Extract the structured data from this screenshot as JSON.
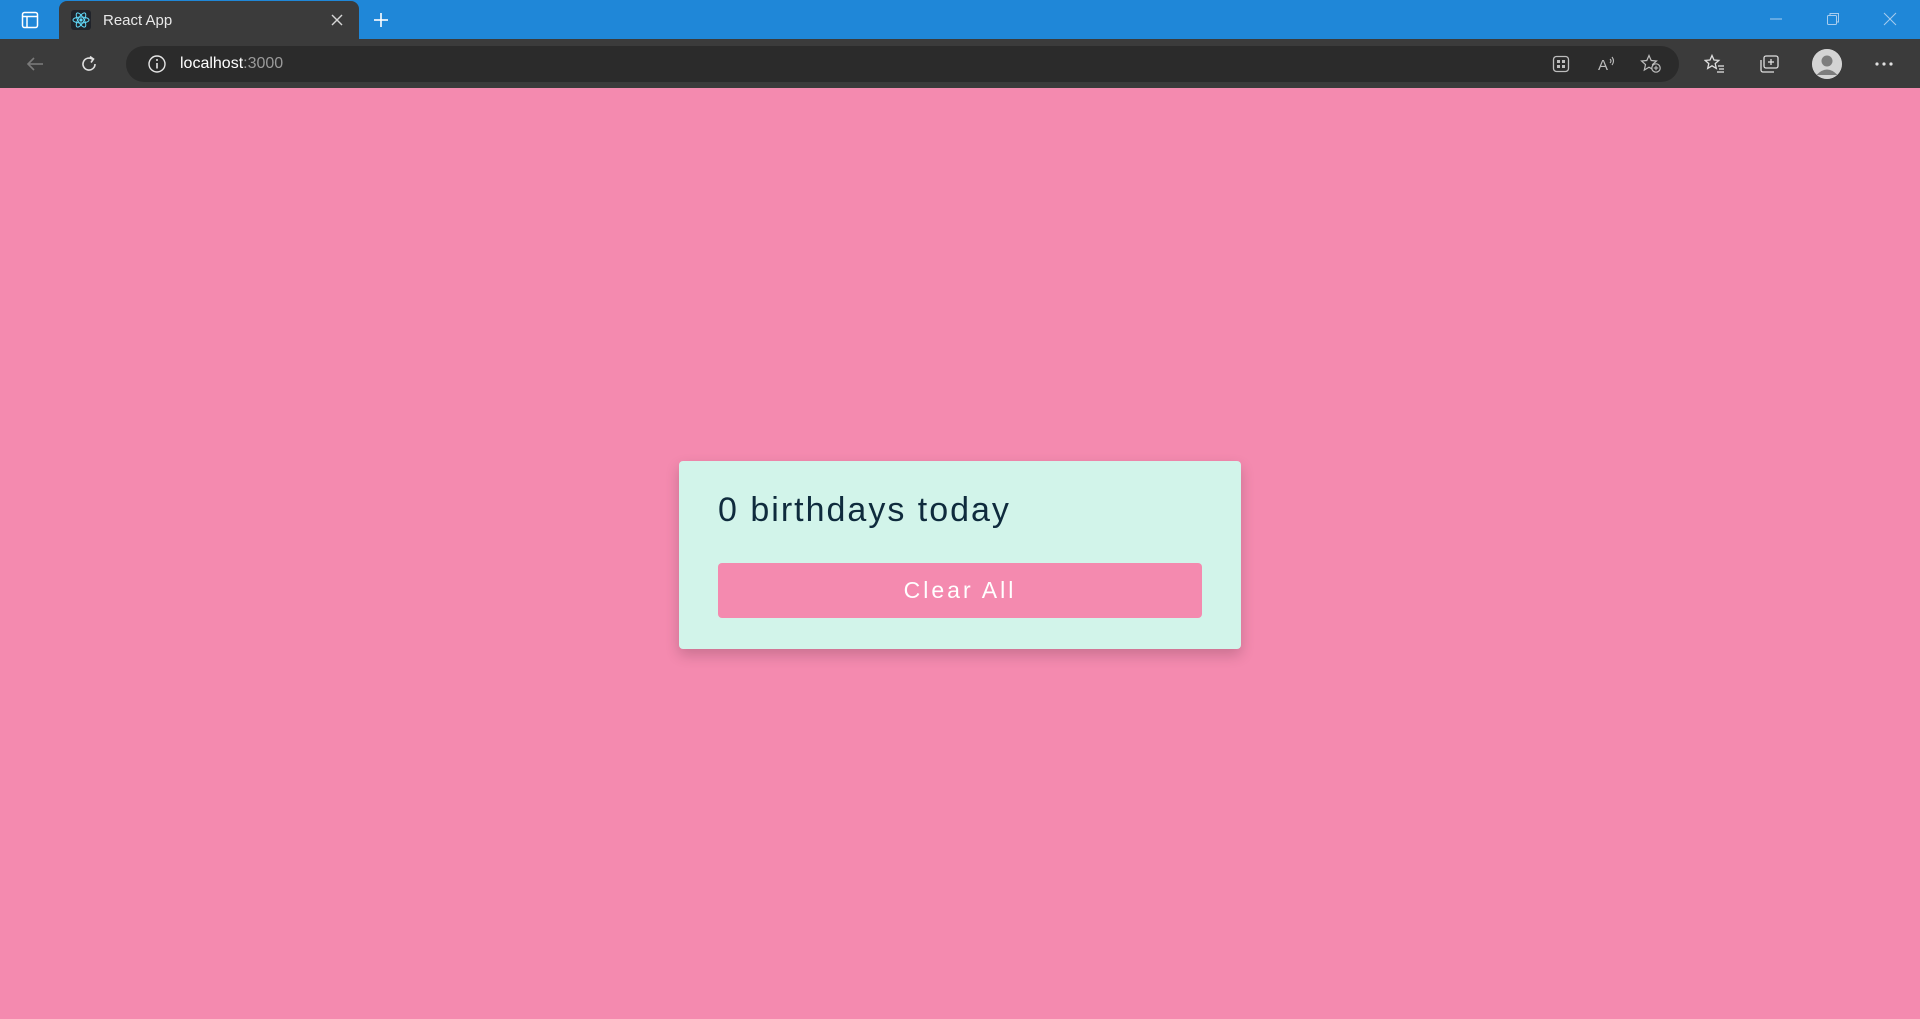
{
  "browser": {
    "tab": {
      "title": "React App",
      "favicon": "react-logo-icon"
    },
    "address": {
      "host": "localhost",
      "port": ":3000"
    },
    "colors": {
      "titlebar": "#1f87d8",
      "toolbar": "#3b3b3b",
      "omnibox": "#2b2b2b"
    }
  },
  "page": {
    "background": "#f48aaf",
    "heading": "0 birthdays today",
    "clear_button": "Clear All",
    "card_color": "#d2f4ea",
    "heading_color": "#0f2b3d"
  }
}
